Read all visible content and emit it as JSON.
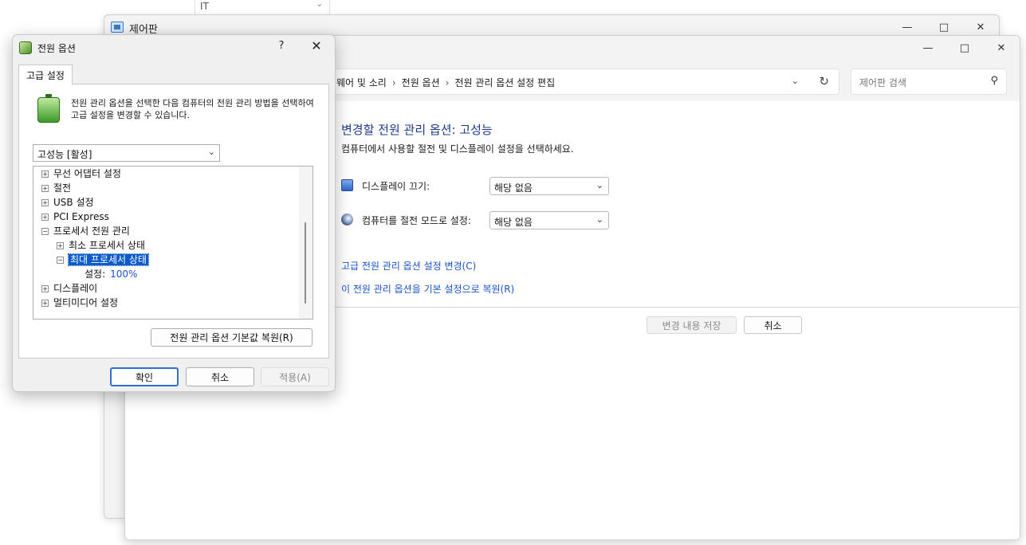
{
  "background_dropdown": {
    "value": "IT"
  },
  "back_window": {
    "title": "제어판"
  },
  "front_window": {
    "breadcrumb": [
      "웨어 및 소리",
      "전원 옵션",
      "전원 관리 옵션 설정 편집"
    ],
    "search_placeholder": "제어판 검색",
    "heading": "변경할 전원 관리 옵션: 고성능",
    "subheading": "컴퓨터에서 사용할 절전 및 디스플레이 설정을 선택하세요.",
    "display_off": {
      "label": "디스플레이 끄기:",
      "value": "해당 없음"
    },
    "sleep": {
      "label": "컴퓨터를 절전 모드로 설정:",
      "value": "해당 없음"
    },
    "link_advanced": "고급 전원 관리 옵션 설정 변경(C)",
    "link_restore": "이 전원 관리 옵션을 기본 설정으로 복원(R)",
    "save_button": "변경 내용 저장",
    "cancel_button": "취소"
  },
  "dialog": {
    "title": "전원 옵션",
    "help": "?",
    "tab": "고급 설정",
    "description": "전원 관리 옵션을 선택한 다음 컴퓨터의 전원 관리 방법을 선택하여 고급 설정을 변경할 수 있습니다.",
    "plan_select": "고성능 [활성]",
    "tree": {
      "wireless": "무선 어댑터 설정",
      "sleep": "절전",
      "usb": "USB 설정",
      "pci": "PCI Express",
      "processor": "프로세서 전원 관리",
      "min_state": "최소 프로세서 상태",
      "max_state": "최대 프로세서 상태",
      "setting_label": "설정:",
      "setting_value": "100%",
      "display": "디스플레이",
      "multimedia": "멀티미디어 설정"
    },
    "restore_defaults": "전원 관리 옵션 기본값 복원(R)",
    "ok": "확인",
    "cancel": "취소",
    "apply": "적용(A)"
  }
}
